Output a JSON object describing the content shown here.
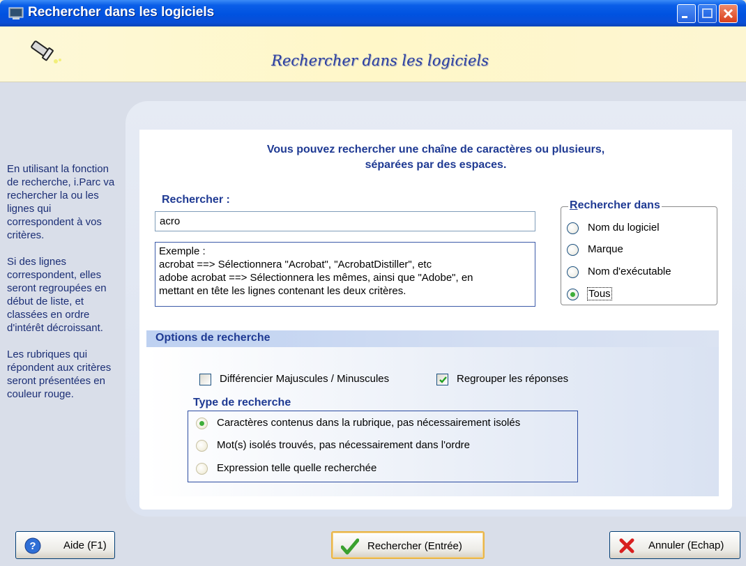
{
  "window": {
    "title": "Rechercher dans les logiciels"
  },
  "banner": {
    "title": "Rechercher dans les logiciels"
  },
  "sidebar": {
    "paragraphs": [
      "En utilisant la fonction de recherche, i.Parc va rechercher la ou les lignes qui correspondent à vos critères.",
      "Si des lignes correspondent, elles seront regroupées en début de liste, et classées en ordre d'intérêt décroissant.",
      "Les rubriques qui répondent aux critères seront présentées en couleur rouge."
    ]
  },
  "main": {
    "intro_line1": "Vous pouvez rechercher une chaîne de caractères ou plusieurs,",
    "intro_line2": "séparées par des espaces.",
    "search_label": "Rechercher :",
    "search_value": "acro",
    "example_lines": [
      "Exemple :",
      "acrobat ==> Sélectionnera \"Acrobat\", \"AcrobatDistiller\", etc",
      "adobe acrobat ==> Sélectionnera les mêmes, ainsi que \"Adobe\", en",
      "mettant en tête les lignes contenant les deux critères."
    ]
  },
  "search_in": {
    "legend_first": "R",
    "legend_rest": "echercher dans",
    "options": [
      {
        "label": "Nom du logiciel",
        "checked": false
      },
      {
        "label": "Marque",
        "checked": false
      },
      {
        "label": "Nom d'exécutable",
        "checked": false
      },
      {
        "label": "Tous",
        "checked": true
      }
    ]
  },
  "options": {
    "header": "Options de recherche",
    "case_sensitive_label": "Différencier Majuscules / Minuscules",
    "case_sensitive_checked": false,
    "group_answers_label": "Regrouper les réponses",
    "group_answers_checked": true,
    "type_legend": "Type de recherche",
    "types": [
      {
        "label": "Caractères contenus dans la rubrique, pas nécessairement isolés",
        "checked": true
      },
      {
        "label": "Mot(s) isolés trouvés, pas nécessairement dans l'ordre",
        "checked": false
      },
      {
        "label": "Expression telle quelle recherchée",
        "checked": false
      }
    ]
  },
  "buttons": {
    "help": "Aide (F1)",
    "search": "Rechercher (Entrée)",
    "cancel": "Annuler (Echap)"
  },
  "colors": {
    "titlebar": "#0052e0",
    "accent_text": "#1f3a93",
    "sidebar_text": "#1b2e75",
    "banner_bg": "#fff7c8"
  }
}
